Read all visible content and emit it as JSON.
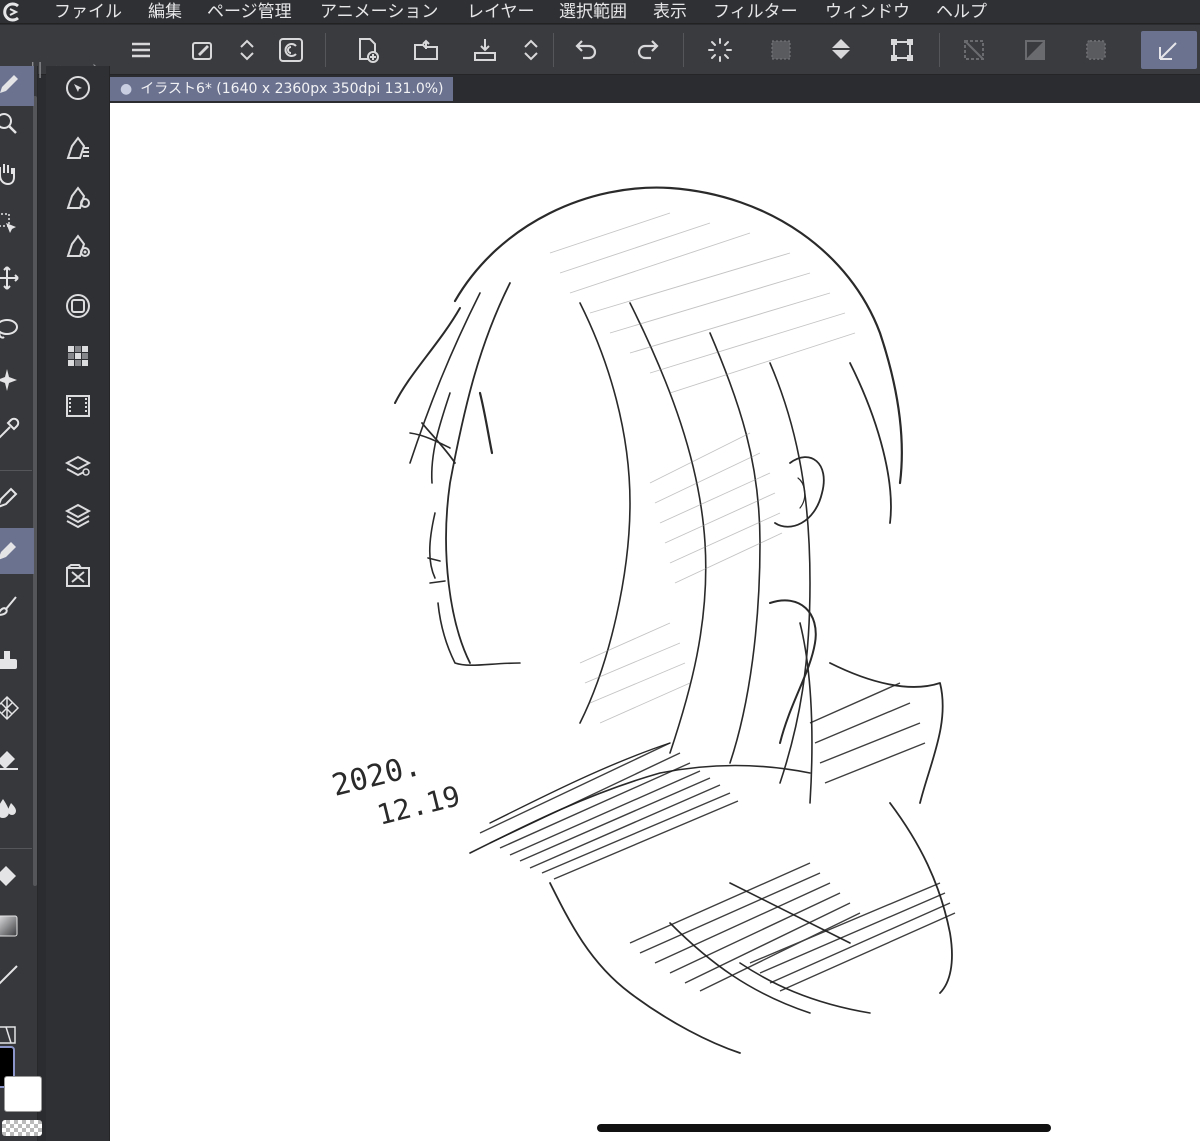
{
  "menu": {
    "items": [
      "ファイル",
      "編集",
      "ページ管理",
      "アニメーション",
      "レイヤー",
      "選択範囲",
      "表示",
      "フィルター",
      "ウィンドウ",
      "ヘルプ"
    ]
  },
  "commandbar": {
    "buttons": [
      "menu-icon",
      "quick-access-icon",
      "up-down-icon",
      "clip-studio-icon",
      "new-canvas-icon",
      "open-folder-icon",
      "save-icon",
      "up-down-icon",
      "undo-icon",
      "redo-icon",
      "loading-icon",
      "clear-selection-icon",
      "fill-icon",
      "crop-icon",
      "hide-selection-icon",
      "invert-selection-icon",
      "selection-border-icon",
      "ruler-snap-icon"
    ],
    "collapse_label": "|| «",
    "expand_label": "›"
  },
  "tools": [
    "pen-icon",
    "zoom-icon",
    "hand-icon",
    "operation-icon",
    "move-icon",
    "lasso-icon",
    "auto-select-icon",
    "eyedropper-icon",
    "pen-tool-icon",
    "pencil-icon",
    "brush-icon",
    "airbrush-icon",
    "decoration-icon",
    "eraser-icon",
    "blend-icon",
    "fill-tool-icon",
    "gradient-icon",
    "line-icon",
    "frame-icon"
  ],
  "palettes": [
    "navigator-icon",
    "sub-tool-icon",
    "tool-property-icon",
    "brush-size-icon",
    "color-wheel-icon",
    "color-set-icon",
    "timeline-icon",
    "layer-property-icon",
    "layer-icon",
    "material-icon"
  ],
  "document": {
    "tab_title": "イラスト6* (1640 x 2360px 350dpi 131.0%)",
    "tab_marker": "●"
  },
  "colors": {
    "main": "#000000",
    "sub": "#ffffff",
    "accent": "#6a7290"
  },
  "sketch": {
    "date_line1": "2020.",
    "date_line2": "12.19"
  }
}
